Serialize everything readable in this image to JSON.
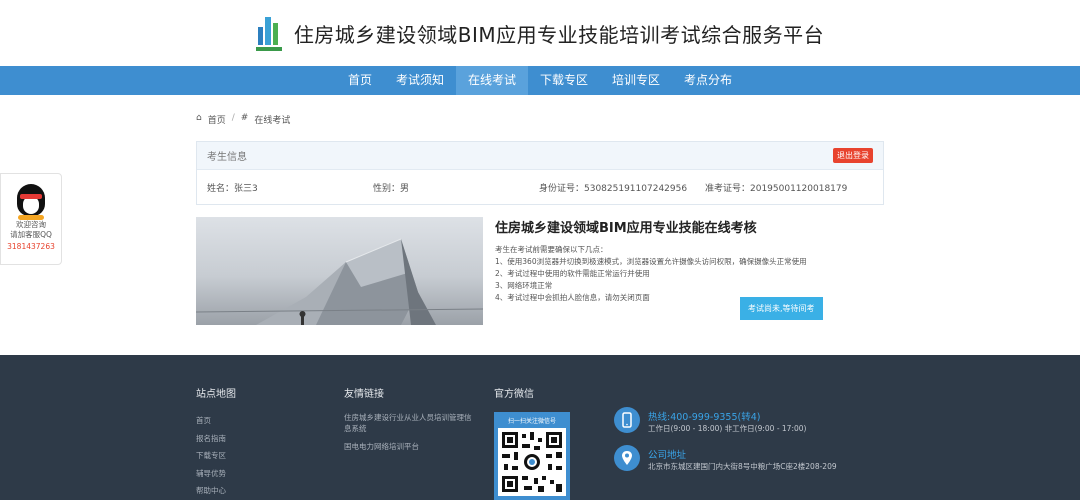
{
  "header": {
    "title": "住房城乡建设领域BIM应用专业技能培训考试综合服务平台"
  },
  "nav": {
    "items": [
      {
        "label": "首页"
      },
      {
        "label": "考试须知"
      },
      {
        "label": "在线考试"
      },
      {
        "label": "下载专区"
      },
      {
        "label": "培训专区"
      },
      {
        "label": "考点分布"
      }
    ],
    "active": "在线考试"
  },
  "breadcrumb": {
    "home": "首页",
    "current": "在线考试"
  },
  "candidate": {
    "section_title": "考生信息",
    "logout_label": "退出登录",
    "name": "姓名：张三3",
    "gender": "性别：男",
    "id_number": "身份证号：530825191107242956",
    "ticket_number": "准考证号：20195001120018179"
  },
  "exam": {
    "title": "住房城乡建设领域BIM应用专业技能在线考核",
    "intro": "考生在考试前需要确保以下几点：",
    "points": [
      "1、使用360浏览器并切换到极速模式，浏览器设置允许摄像头访问权限，确保摄像头正常使用",
      "2、考试过程中使用的软件需能正常运行并使用",
      "3、网络环境正常",
      "4、考试过程中会抓拍人脸信息，请勿关闭页面"
    ],
    "button_label": "考试尚未,等待间考"
  },
  "qq_widget": {
    "line1": "欢迎咨询",
    "line2": "请加客服QQ",
    "number": "3181437263"
  },
  "footer": {
    "sitemap": {
      "title": "站点地图",
      "links": [
        "首页",
        "报名指南",
        "下载专区",
        "辅导优势",
        "帮助中心"
      ]
    },
    "friends": {
      "title": "友情链接",
      "links": [
        "住房城乡建设行业从业人员培训管理信息系统",
        "国电电力网络培训平台"
      ]
    },
    "wechat": {
      "title": "官方微信",
      "caption": "扫一扫关注微信号"
    },
    "hotline": {
      "title": "热线:400-999-9355(转4)",
      "hours": "工作日(9:00 - 18:00) 非工作日(9:00 - 17:00)"
    },
    "address": {
      "title": "公司地址",
      "text": "北京市东城区建国门内大街8号中粮广场C座2楼208-209"
    }
  },
  "colors": {
    "nav": "#3e8ed0",
    "footer": "#2e3a48",
    "accent": "#3ab0e6",
    "danger": "#e8432e"
  }
}
